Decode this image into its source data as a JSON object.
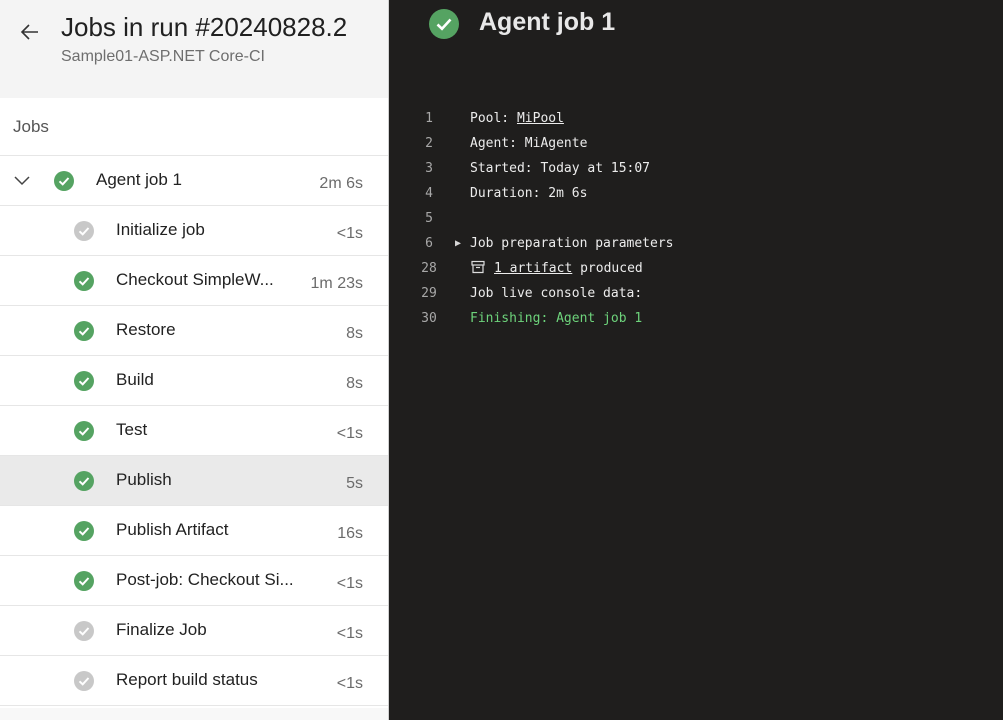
{
  "header": {
    "title": "Jobs in run #20240828.2",
    "subtitle": "Sample01-ASP.NET Core-CI"
  },
  "jobs_panel": {
    "heading": "Jobs",
    "job": {
      "name": "Agent job 1",
      "duration": "2m 6s",
      "status": "success"
    },
    "steps": [
      {
        "name": "Initialize job",
        "duration": "<1s",
        "status": "skipped"
      },
      {
        "name": "Checkout SimpleW...",
        "duration": "1m 23s",
        "status": "success"
      },
      {
        "name": "Restore",
        "duration": "8s",
        "status": "success"
      },
      {
        "name": "Build",
        "duration": "8s",
        "status": "success"
      },
      {
        "name": "Test",
        "duration": "<1s",
        "status": "success"
      },
      {
        "name": "Publish",
        "duration": "5s",
        "status": "success"
      },
      {
        "name": "Publish Artifact",
        "duration": "16s",
        "status": "success"
      },
      {
        "name": "Post-job: Checkout Si...",
        "duration": "<1s",
        "status": "success"
      },
      {
        "name": "Finalize Job",
        "duration": "<1s",
        "status": "skipped"
      },
      {
        "name": "Report build status",
        "duration": "<1s",
        "status": "skipped"
      }
    ]
  },
  "log_panel": {
    "title": "Agent job 1",
    "lines": [
      {
        "num": "1",
        "prefix": "Pool: ",
        "link": "MiPool"
      },
      {
        "num": "2",
        "text": "Agent: MiAgente"
      },
      {
        "num": "3",
        "text": "Started: Today at 15:07"
      },
      {
        "num": "4",
        "text": "Duration: 2m 6s"
      },
      {
        "num": "5",
        "text": ""
      },
      {
        "num": "6",
        "text": "Job preparation parameters"
      },
      {
        "num": "28",
        "link": "1 artifact",
        "suffix": " produced"
      },
      {
        "num": "29",
        "text": "Job live console data:"
      },
      {
        "num": "30",
        "text": "Finishing: Agent job 1"
      }
    ]
  },
  "colors": {
    "success": "#55a362",
    "skipped": "#c8c8c8",
    "finishing_text": "#6dd37b"
  },
  "icons": {
    "back": "arrow-left-icon",
    "collapse": "chevron-down-icon",
    "success": "check-circle-icon",
    "skipped": "check-circle-gray-icon",
    "expand": "triangle-right-icon",
    "artifact": "archive-box-icon"
  }
}
